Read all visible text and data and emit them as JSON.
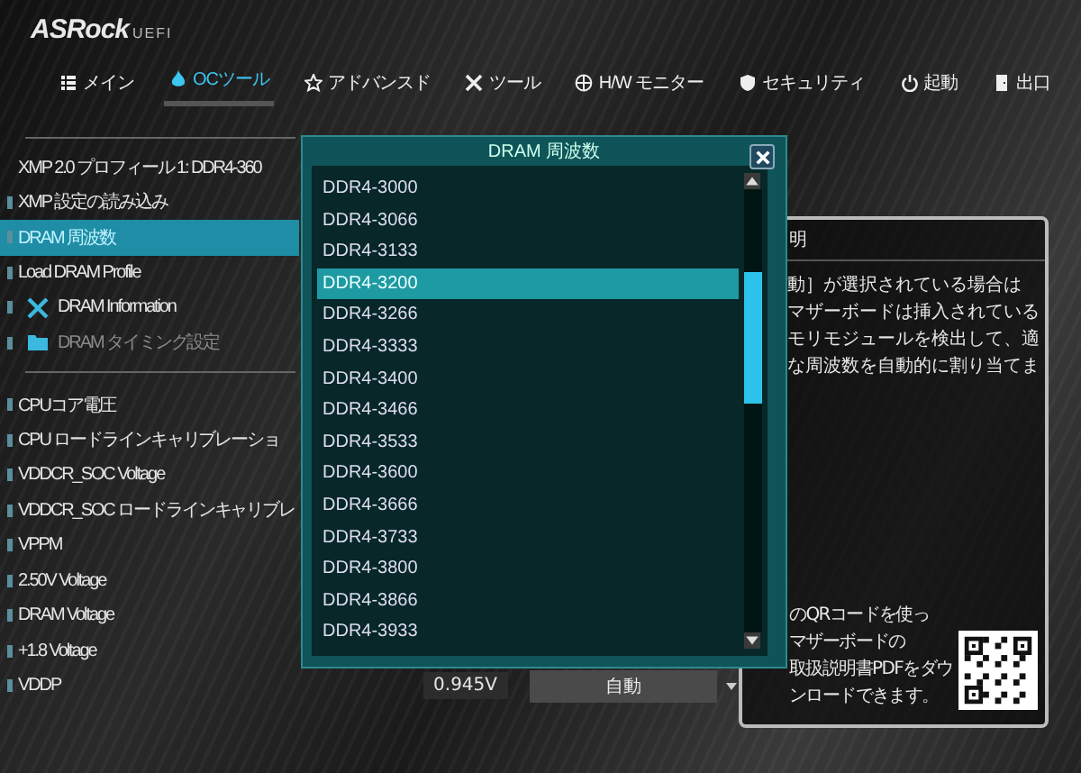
{
  "logo": {
    "brand": "ASRock",
    "suffix": "UEFI"
  },
  "tabs": [
    {
      "label": "メイン",
      "selected": false
    },
    {
      "label": "OCツール",
      "selected": true
    },
    {
      "label": "アドバンスド",
      "selected": false
    },
    {
      "label": "ツール",
      "selected": false
    },
    {
      "label": "H/W モニター",
      "selected": false
    },
    {
      "label": "セキュリティ",
      "selected": false
    },
    {
      "label": "起動",
      "selected": false
    },
    {
      "label": "出口",
      "selected": false
    }
  ],
  "settings": [
    {
      "kind": "info",
      "label": "XMP 2.0 プロフィール 1: DDR4-360",
      "selected": false
    },
    {
      "kind": "item",
      "label": "XMP 設定の読み込み",
      "selected": false
    },
    {
      "kind": "item",
      "label": "DRAM 周波数",
      "selected": true
    },
    {
      "kind": "item",
      "label": "Load DRAM Profile",
      "selected": false
    },
    {
      "kind": "tool",
      "label": "DRAM Information",
      "selected": false
    },
    {
      "kind": "folder",
      "label": "DRAM タイミング設定",
      "selected": false,
      "disabled": true
    },
    {
      "kind": "divider"
    },
    {
      "kind": "item",
      "label": "CPUコア電圧",
      "selected": false
    },
    {
      "kind": "item",
      "label": "CPU ロードラインキャリブレーショ",
      "selected": false
    },
    {
      "kind": "item",
      "label": "VDDCR_SOC Voltage",
      "selected": false
    },
    {
      "kind": "item",
      "label": "VDDCR_SOC ロードラインキャリブレ",
      "selected": false
    },
    {
      "kind": "item",
      "label": "VPPM",
      "selected": false
    },
    {
      "kind": "item",
      "label": "2.50V Voltage",
      "selected": false
    },
    {
      "kind": "item",
      "label": "DRAM Voltage",
      "selected": false
    },
    {
      "kind": "item",
      "label": "+1.8 Voltage",
      "selected": false
    },
    {
      "kind": "item",
      "label": "VDDP",
      "selected": false,
      "value": "0.945V",
      "option": "自動"
    }
  ],
  "help": {
    "title": "明",
    "lines": [
      "動］が選択されている場合は",
      "マザーボードは挿入されている",
      "モリモジュールを検出して、適",
      "な周波数を自動的に割り当てま"
    ],
    "qr_lines": [
      "のQRコードを使っ",
      "マザーボードの",
      "取扱説明書PDFをダウ",
      "ンロードできます。"
    ]
  },
  "popup": {
    "title": "DRAM 周波数",
    "options": [
      {
        "label": "DDR4-3000",
        "selected": false
      },
      {
        "label": "DDR4-3066",
        "selected": false
      },
      {
        "label": "DDR4-3133",
        "selected": false
      },
      {
        "label": "DDR4-3200",
        "selected": true
      },
      {
        "label": "DDR4-3266",
        "selected": false
      },
      {
        "label": "DDR4-3333",
        "selected": false
      },
      {
        "label": "DDR4-3400",
        "selected": false
      },
      {
        "label": "DDR4-3466",
        "selected": false
      },
      {
        "label": "DDR4-3533",
        "selected": false
      },
      {
        "label": "DDR4-3600",
        "selected": false
      },
      {
        "label": "DDR4-3666",
        "selected": false
      },
      {
        "label": "DDR4-3733",
        "selected": false
      },
      {
        "label": "DDR4-3800",
        "selected": false
      },
      {
        "label": "DDR4-3866",
        "selected": false
      },
      {
        "label": "DDR4-3933",
        "selected": false
      }
    ]
  }
}
